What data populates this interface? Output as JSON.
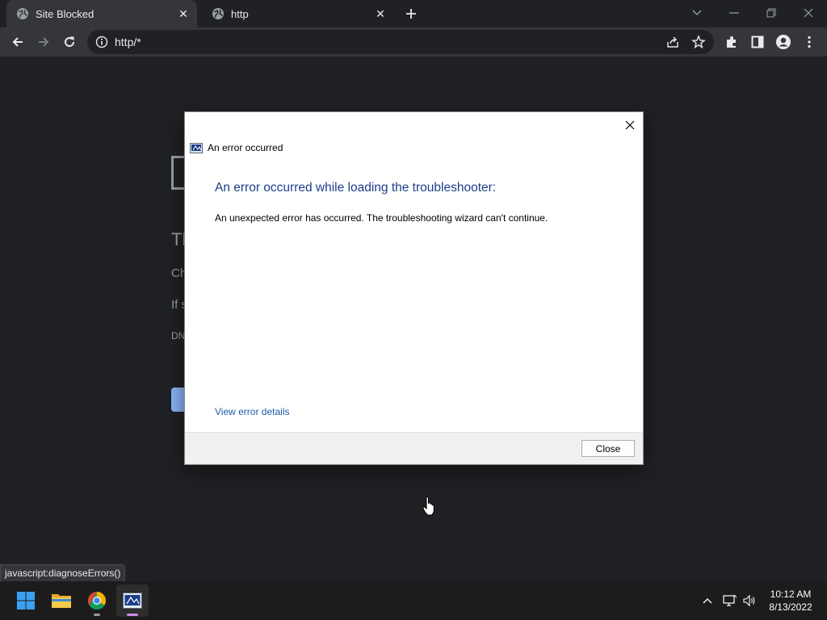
{
  "browser": {
    "tabs": [
      {
        "title": "Site Blocked",
        "close": "✕"
      },
      {
        "title": "http",
        "close": "✕"
      }
    ],
    "new_tab": "+",
    "address": "http/*"
  },
  "background_page": {
    "snippets": [
      "Tl",
      "Ch",
      "If s",
      "DN"
    ]
  },
  "dialog": {
    "title": "An error occurred",
    "heading": "An error occurred while loading the troubleshooter:",
    "message": "An unexpected error has occurred. The troubleshooting wizard can't continue.",
    "link": "View error details",
    "close_button": "Close",
    "close_glyph": "✕"
  },
  "status_bar": {
    "text": "javascript:diagnoseErrors()"
  },
  "taskbar": {
    "time": "10:12 AM",
    "date": "8/13/2022"
  },
  "colors": {
    "accent_link": "#1e5ba8",
    "heading_blue": "#1e3e8a",
    "browser_dark": "#202124",
    "toolbar": "#35363a"
  }
}
